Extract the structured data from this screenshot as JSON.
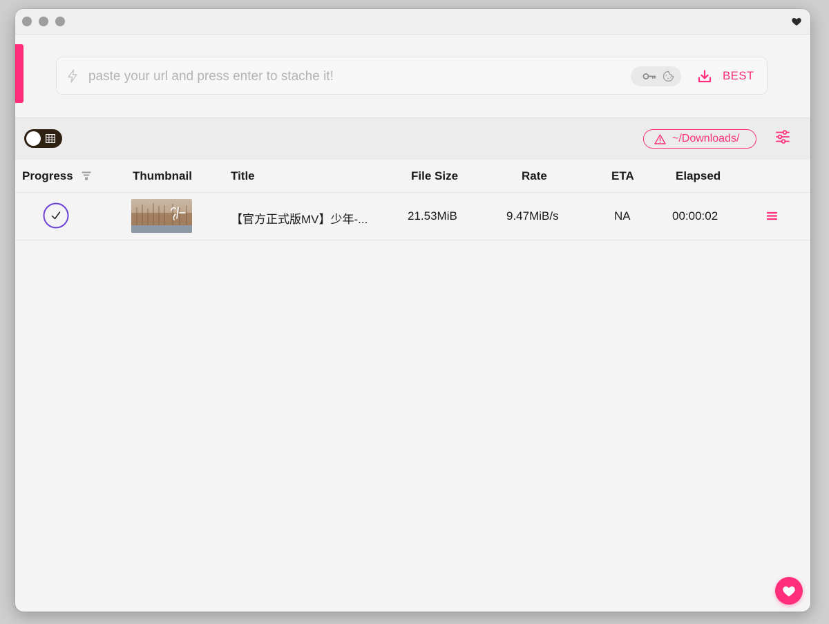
{
  "window": {
    "traffic_lights": [
      "close",
      "minimize",
      "maximize"
    ],
    "title_icon": "heart-icon"
  },
  "url_bar": {
    "placeholder": "paste your url and press enter to stache it!",
    "value": "",
    "leading_icon": "bolt-icon",
    "auth_icons": [
      "key-icon",
      "cookie-icon"
    ],
    "format_icon": "download-icon",
    "format_label": "BEST"
  },
  "toolbar": {
    "view_toggle_icon": "table-grid-icon",
    "download_path": "~/Downloads/",
    "path_icon": "warning-icon",
    "settings_icon": "sliders-icon"
  },
  "table": {
    "columns": [
      "Progress",
      "Thumbnail",
      "Title",
      "File Size",
      "Rate",
      "ETA",
      "Elapsed"
    ],
    "rows": [
      {
        "status": "complete",
        "status_icon": "check-circle-icon",
        "title": "【官方正式版MV】少年-...",
        "file_size": "21.53MiB",
        "rate": "9.47MiB/s",
        "eta": "NA",
        "elapsed": "00:00:02",
        "menu_icon": "hamburger-menu-icon"
      }
    ]
  },
  "colors": {
    "accent": "#ff2d7a",
    "toggle_bg": "#2f2112",
    "progress_ring": "#6c3fd6",
    "background": "#f4f4f4"
  },
  "fab": {
    "icon": "heart-icon"
  }
}
